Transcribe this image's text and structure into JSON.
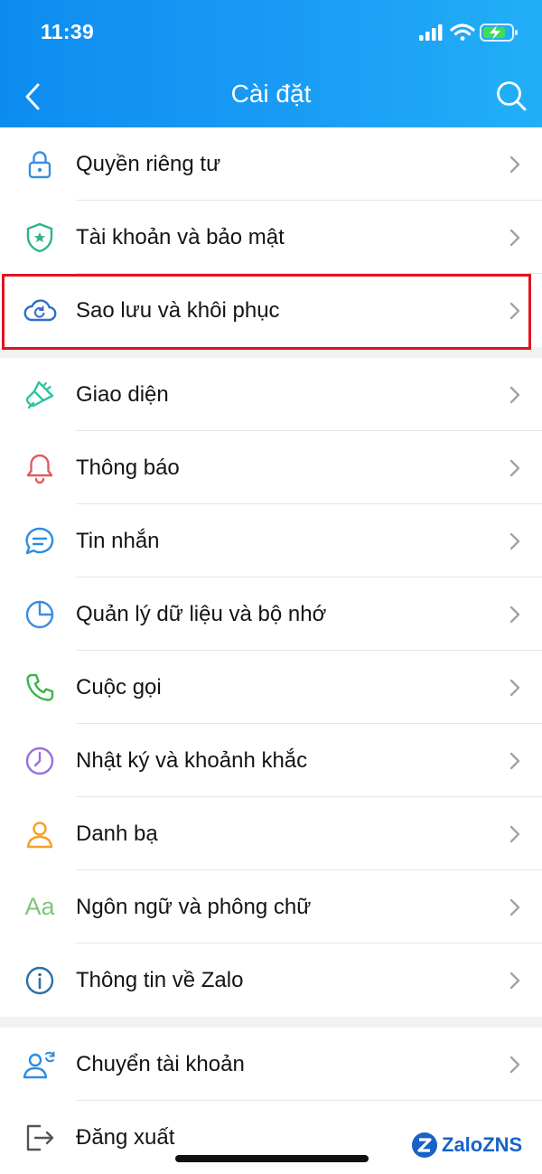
{
  "status_bar": {
    "time": "11:39"
  },
  "header": {
    "title": "Cài đặt"
  },
  "groups": [
    {
      "items": [
        {
          "label": "Quyền riêng tư",
          "icon": "lock-icon",
          "color": "#3a8de0"
        },
        {
          "label": "Tài khoản và bảo mật",
          "icon": "shield-icon",
          "color": "#2bb58a"
        },
        {
          "label": "Sao lưu và khôi phục",
          "icon": "cloud-sync-icon",
          "color": "#2f6fc9",
          "highlighted": true
        }
      ]
    },
    {
      "items": [
        {
          "label": "Giao diện",
          "icon": "paint-brush-icon",
          "color": "#2fc4a0"
        },
        {
          "label": "Thông báo",
          "icon": "bell-icon",
          "color": "#e25a5a"
        },
        {
          "label": "Tin nhắn",
          "icon": "message-icon",
          "color": "#2d8de2"
        },
        {
          "label": "Quản lý dữ liệu và bộ nhớ",
          "icon": "pie-chart-icon",
          "color": "#3a8de0"
        },
        {
          "label": "Cuộc gọi",
          "icon": "phone-icon",
          "color": "#3bb54a"
        },
        {
          "label": "Nhật ký và khoảnh khắc",
          "icon": "clock-icon",
          "color": "#9a6ee0"
        },
        {
          "label": "Danh bạ",
          "icon": "person-icon",
          "color": "#f2a227"
        },
        {
          "label": "Ngôn ngữ và phông chữ",
          "icon": "font-icon",
          "icon_text": "Aa",
          "color": "#7cc57a"
        },
        {
          "label": "Thông tin về Zalo",
          "icon": "info-icon",
          "color": "#2a6fa8"
        }
      ]
    },
    {
      "items": [
        {
          "label": "Chuyển tài khoản",
          "icon": "switch-account-icon",
          "color": "#2d8de2"
        },
        {
          "label": "Đăng xuất",
          "icon": "logout-icon",
          "color": "#555555"
        }
      ]
    }
  ],
  "watermark": {
    "text": "ZaloZNS"
  },
  "colors": {
    "header_start": "#0d8cf0",
    "header_end": "#22aff7",
    "highlight_border": "#e2131f"
  }
}
